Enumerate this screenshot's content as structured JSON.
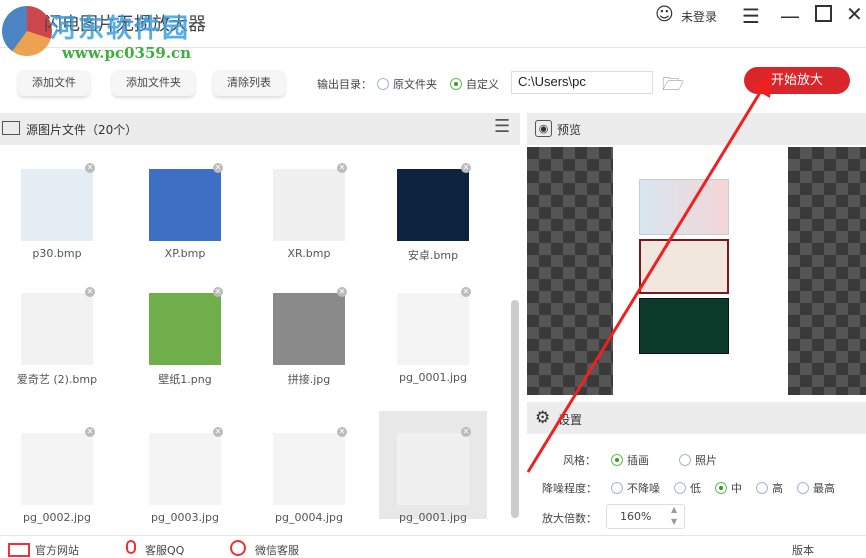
{
  "app": {
    "title": "闪电图片无损放大器",
    "watermark_cn": "河东软件园",
    "watermark_url": "www.pc0359.cn",
    "user": "未登录"
  },
  "toolbar": {
    "add_file": "添加文件",
    "add_folder": "添加文件夹",
    "clear_list": "清除列表",
    "output_label": "输出目录：",
    "opt_original": "原文件夹",
    "opt_custom": "自定义",
    "path": "C:\\Users\\pc",
    "start": "开始放大"
  },
  "source": {
    "title": "源图片文件（20个）",
    "files": [
      "p30.bmp",
      "XP.bmp",
      "XR.bmp",
      "安卓.bmp",
      "爱奇艺 (2).bmp",
      "壁纸1.png",
      "拼接.jpg",
      "pg_0001.jpg",
      "pg_0002.jpg",
      "pg_0003.jpg",
      "pg_0004.jpg",
      "pg_0001.jpg"
    ],
    "thumb_colors": [
      "#e6eef5",
      "#3d6fc4",
      "#f0f0f0",
      "#0d2340",
      "#f2f2f2",
      "#6fae4a",
      "#8a8a8a",
      "#f4f4f4",
      "#f4f4f4",
      "#f4f4f4",
      "#f4f4f4",
      "#f0f0f0"
    ],
    "selected_index": 11
  },
  "preview": {
    "title": "预览"
  },
  "settings": {
    "title": "设置",
    "style_label": "风格：",
    "style_opts": [
      "插画",
      "照片"
    ],
    "style_selected": 0,
    "noise_label": "降噪程度：",
    "noise_opts": [
      "不降噪",
      "低",
      "中",
      "高",
      "最高"
    ],
    "noise_selected": 2,
    "scale_label": "放大倍数：",
    "scale_value": "160%"
  },
  "footer": {
    "items": [
      "官方网站",
      "客服QQ",
      "微信客服"
    ],
    "version": "版本"
  },
  "colors": {
    "accent": "#d9262a",
    "radio_on": "#3a9a1a"
  }
}
